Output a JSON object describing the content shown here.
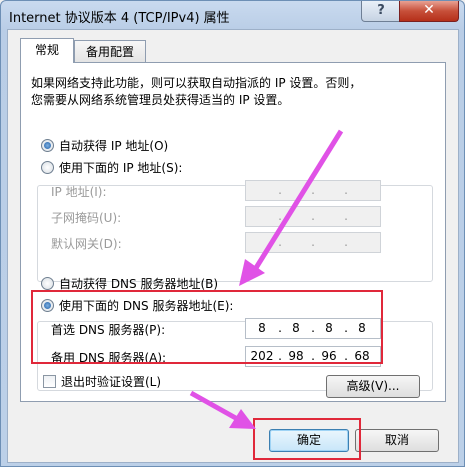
{
  "window": {
    "title": "Internet 协议版本 4 (TCP/IPv4) 属性",
    "help_label": "?",
    "close_label": "✕"
  },
  "tabs": [
    {
      "label": "常规",
      "active": true
    },
    {
      "label": "备用配置",
      "active": false
    }
  ],
  "description": [
    "如果网络支持此功能，则可以获取自动指派的 IP 设置。否则，",
    "您需要从网络系统管理员处获得适当的 IP 设置。"
  ],
  "ip": {
    "auto_label": "自动获得 IP 地址(O)",
    "manual_label": "使用下面的 IP 地址(S):",
    "selected": "auto",
    "fields": [
      {
        "label": "IP 地址(I):",
        "octets": [
          "",
          "",
          "",
          ""
        ]
      },
      {
        "label": "子网掩码(U):",
        "octets": [
          "",
          "",
          "",
          ""
        ]
      },
      {
        "label": "默认网关(D):",
        "octets": [
          "",
          "",
          "",
          ""
        ]
      }
    ]
  },
  "dns": {
    "auto_label": "自动获得 DNS 服务器地址(B)",
    "manual_label": "使用下面的 DNS 服务器地址(E):",
    "selected": "manual",
    "fields": [
      {
        "label": "首选 DNS 服务器(P):",
        "octets": [
          "8",
          "8",
          "8",
          "8"
        ]
      },
      {
        "label": "备用 DNS 服务器(A):",
        "octets": [
          "202",
          "98",
          "96",
          "68"
        ]
      }
    ]
  },
  "validate_label": "退出时验证设置(L)",
  "advanced_label": "高级(V)...",
  "ok_label": "确定",
  "cancel_label": "取消",
  "colors": {
    "highlight": "#e0283a",
    "arrow": "#e052e6"
  }
}
